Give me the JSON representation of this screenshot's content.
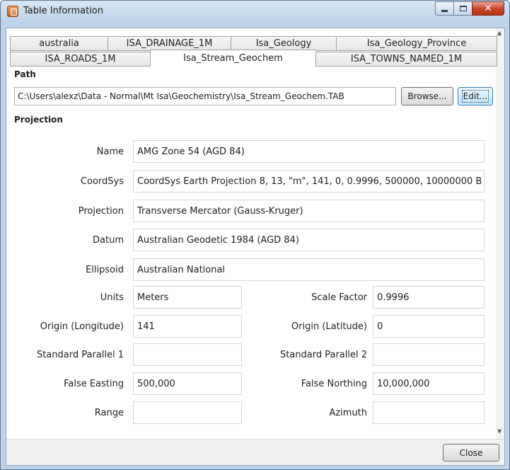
{
  "window": {
    "title": "Table Information"
  },
  "tabs": {
    "row1": [
      "australia",
      "ISA_DRAINAGE_1M",
      "Isa_Geology",
      "Isa_Geology_Province"
    ],
    "row2": [
      "ISA_ROADS_1M",
      "Isa_Stream_Geochem",
      "ISA_TOWNS_NAMED_1M"
    ],
    "active": "Isa_Stream_Geochem"
  },
  "path": {
    "label": "Path",
    "value": "C:\\Users\\alexz\\Data - Normal\\Mt Isa\\Geochemistry\\Isa_Stream_Geochem.TAB",
    "browse_label": "Browse...",
    "edit_label": "Edit..."
  },
  "projection": {
    "label": "Projection",
    "name_label": "Name",
    "name_value": "AMG Zone 54 (AGD 84)",
    "coordsys_label": "CoordSys",
    "coordsys_value": "CoordSys Earth Projection 8, 13, \"m\", 141, 0, 0.9996, 500000, 10000000 B",
    "projection_label": "Projection",
    "projection_value": "Transverse Mercator (Gauss-Kruger)",
    "datum_label": "Datum",
    "datum_value": "Australian Geodetic 1984 (AGD 84)",
    "ellipsoid_label": "Ellipsoid",
    "ellipsoid_value": "Australian National",
    "units_label": "Units",
    "units_value": "Meters",
    "scale_factor_label": "Scale Factor",
    "scale_factor_value": "0.9996",
    "origin_lon_label": "Origin (Longitude)",
    "origin_lon_value": "141",
    "origin_lat_label": "Origin (Latitude)",
    "origin_lat_value": "0",
    "std_parallel1_label": "Standard Parallel 1",
    "std_parallel1_value": "",
    "std_parallel2_label": "Standard Parallel 2",
    "std_parallel2_value": "",
    "false_easting_label": "False Easting",
    "false_easting_value": "500,000",
    "false_northing_label": "False Northing",
    "false_northing_value": "10,000,000",
    "range_label": "Range",
    "range_value": "",
    "azimuth_label": "Azimuth",
    "azimuth_value": ""
  },
  "footer": {
    "close_label": "Close"
  }
}
